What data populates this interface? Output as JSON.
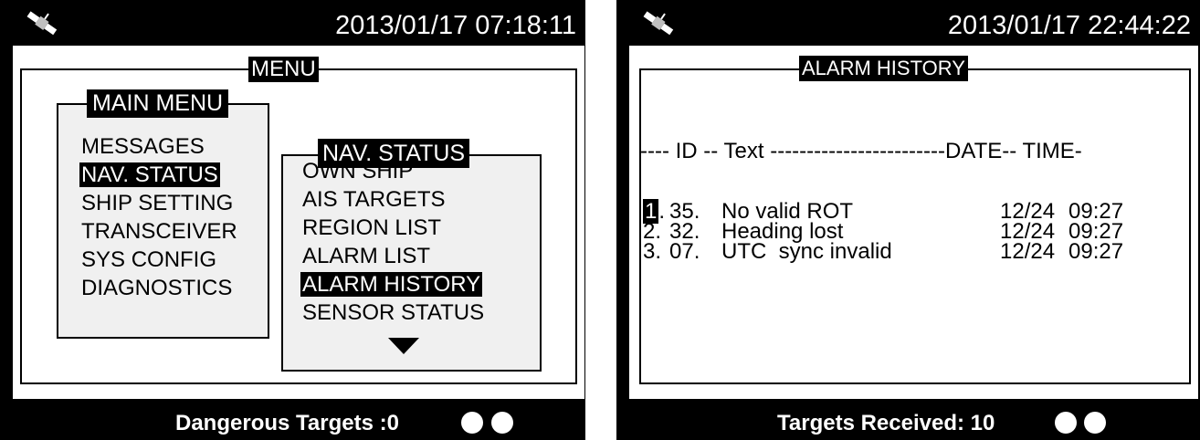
{
  "left_screen": {
    "datetime": "2013/01/17 07:18:11",
    "menu_title": "MENU",
    "main_menu": {
      "title": "MAIN MENU",
      "items": [
        {
          "label": "MESSAGES",
          "selected": false
        },
        {
          "label": "NAV. STATUS",
          "selected": true
        },
        {
          "label": "SHIP SETTING",
          "selected": false
        },
        {
          "label": "TRANSCEIVER",
          "selected": false
        },
        {
          "label": "SYS CONFIG",
          "selected": false
        },
        {
          "label": "DIAGNOSTICS",
          "selected": false
        }
      ]
    },
    "nav_status": {
      "title": "NAV. STATUS",
      "items": [
        {
          "label": "OWN SHIP",
          "selected": false
        },
        {
          "label": "AIS TARGETS",
          "selected": false
        },
        {
          "label": "REGION LIST",
          "selected": false
        },
        {
          "label": "ALARM LIST",
          "selected": false
        },
        {
          "label": "ALARM HISTORY",
          "selected": true
        },
        {
          "label": "SENSOR STATUS",
          "selected": false
        }
      ],
      "more_icon": "triangle-down-icon"
    },
    "footer_text": "Dangerous Targets :0"
  },
  "right_screen": {
    "datetime": "2013/01/17 22:44:22",
    "title": "ALARM HISTORY",
    "header_line": "---- ID -- Text ------------------------DATE-- TIME-",
    "rows": [
      {
        "index": "1",
        "id": "35.",
        "text": "No valid ROT",
        "date": "12/24",
        "time": "09:27"
      },
      {
        "index": "2.",
        "id": "32.",
        "text": "Heading lost",
        "date": "12/24",
        "time": "09:27"
      },
      {
        "index": "3.",
        "id": "07.",
        "text": "UTC  sync invalid",
        "date": "12/24",
        "time": "09:27"
      }
    ],
    "footer_text": "Targets Received: 10"
  },
  "icons": {
    "satellite": "satellite-icon",
    "status_dot": "status-dot-icon"
  }
}
